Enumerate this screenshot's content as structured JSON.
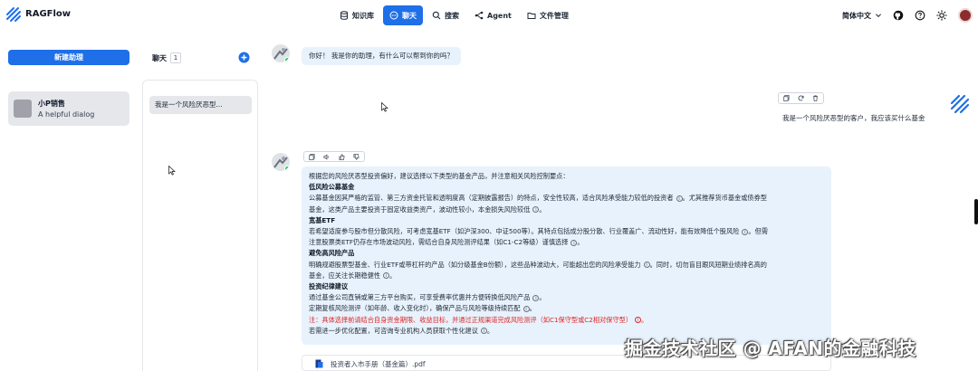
{
  "app": {
    "brand": "RAGFlow"
  },
  "nav": {
    "items": [
      {
        "label": "知识库",
        "icon": "database-icon",
        "active": false
      },
      {
        "label": "聊天",
        "icon": "chat-bubble-icon",
        "active": true
      },
      {
        "label": "搜索",
        "icon": "search-icon",
        "active": false
      },
      {
        "label": "Agent",
        "icon": "agent-graph-icon",
        "active": false
      },
      {
        "label": "文件管理",
        "icon": "folder-icon",
        "active": false
      }
    ],
    "language": "简体中文"
  },
  "sidebar": {
    "new_button": "新建助理",
    "dialogs": [
      {
        "name": "小P销售",
        "description": "A helpful dialog"
      }
    ]
  },
  "conversations": {
    "title": "聊天",
    "count": "1",
    "items": [
      {
        "label": "我是一个风险厌恶型..."
      }
    ]
  },
  "chat": {
    "greeting": "你好！ 我是你的助理，有什么可以帮到你的吗？",
    "user_message": "我是一个风险厌恶型的客户，我应该买什么基金",
    "answer_lines": [
      {
        "text": "根据您的风险厌恶型投资偏好，建议选择以下类型的基金产品，并注意相关风险控制要点：",
        "style": "normal",
        "cite": false
      },
      {
        "text": "低风险公募基金",
        "style": "h",
        "cite": false
      },
      {
        "text": "公募基金因其严格的监管、第三方资金托管和透明度高（定期披露报告）的特点，安全性较高，适合风险承受能力较低的投资者",
        "style": "normal",
        "cite": true,
        "tail": "。尤其推荐货币基金或债券型"
      },
      {
        "text": "基金，这类产品主要投资于固定收益类资产，波动性较小，本金损失风险较低",
        "style": "normal",
        "cite": true,
        "tail": "。"
      },
      {
        "text": "宽基ETF",
        "style": "h",
        "cite": false
      },
      {
        "text": "若希望适度参与股市但分散风险，可考虑宽基ETF（如沪深300、中证500等）。其特点包括成分股分散、行业覆盖广、流动性好，能有效降低个股风险",
        "style": "normal",
        "cite": true,
        "tail": "。但需"
      },
      {
        "text": "注意股票类ETF仍存在市场波动风险，需结合自身风险测评结果（如C1-C2等级）谨慎选择",
        "style": "normal",
        "cite": true,
        "tail": "。"
      },
      {
        "text": "避免高风险产品",
        "style": "h",
        "cite": false
      },
      {
        "text": "明确规避股票型基金、行业ETF或带杠杆的产品（如分级基金B份额），这些品种波动大，可能超出您的风险承受能力",
        "style": "normal",
        "cite": true,
        "tail": "。同时，切勿盲目跟风短期业绩排名高的"
      },
      {
        "text": "基金，应关注长期稳健性",
        "style": "normal",
        "cite": true,
        "tail": "。"
      },
      {
        "text": "投资纪律建议",
        "style": "h",
        "cite": false
      },
      {
        "text": "通过基金公司直销或第三方平台购买，可享受费率优惠并方便转换低风险产品",
        "style": "normal",
        "cite": true,
        "tail": "。"
      },
      {
        "text": "定期复核风险测评（如年龄、收入变化时），确保产品与风险等级持续匹配",
        "style": "normal",
        "cite": true,
        "tail": "。"
      },
      {
        "text": "注：具体选择前请结合自身资金期限、收益目标，并通过正规渠道完成风险测评（如C1保守型或C2相对保守型）",
        "style": "warn",
        "cite": true,
        "tail": "。"
      },
      {
        "text": "若需进一步优化配置，可咨询专业机构人员获取个性化建议",
        "style": "normal",
        "cite": true,
        "tail": "。"
      }
    ],
    "reference_doc": "投资者入市手册（基金篇）.pdf"
  },
  "watermark": "掘金技术社区 @ AFAN的金融科技",
  "colors": {
    "accent": "#1e6fe8",
    "bubble": "#e8f2fc",
    "warning": "#dc2626"
  }
}
